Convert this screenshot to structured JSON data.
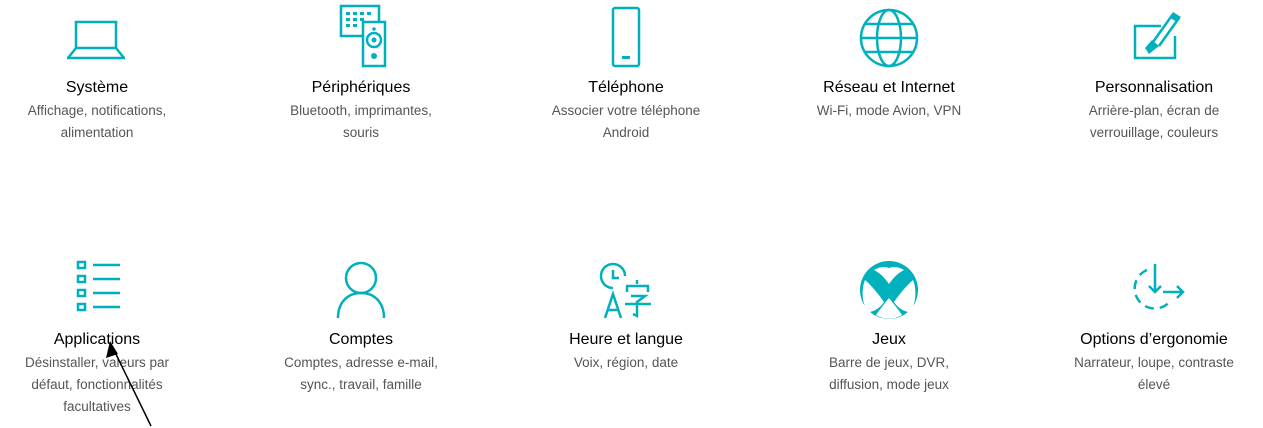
{
  "accent_color": "#00b0bc",
  "tiles": [
    {
      "title": "Système",
      "desc1": "Affichage, notifications,",
      "desc2": "alimentation",
      "desc3": "",
      "icon": "laptop-icon"
    },
    {
      "title": "Périphériques",
      "desc1": "Bluetooth, imprimantes,",
      "desc2": "souris",
      "desc3": "",
      "icon": "devices-icon"
    },
    {
      "title": "Téléphone",
      "desc1": "Associer votre téléphone",
      "desc2": "Android",
      "desc3": "",
      "icon": "phone-icon"
    },
    {
      "title": "Réseau et Internet",
      "desc1": "Wi-Fi, mode Avion, VPN",
      "desc2": "",
      "desc3": "",
      "icon": "globe-icon"
    },
    {
      "title": "Personnalisation",
      "desc1": "Arrière-plan, écran de",
      "desc2": "verrouillage, couleurs",
      "desc3": "",
      "icon": "paintbrush-icon"
    },
    {
      "title": "Applications",
      "desc1": "Désinstaller, valeurs par",
      "desc2": "défaut, fonctionnalités",
      "desc3": "facultatives",
      "icon": "apps-list-icon"
    },
    {
      "title": "Comptes",
      "desc1": "Comptes, adresse e-mail,",
      "desc2": "sync., travail, famille",
      "desc3": "",
      "icon": "person-icon"
    },
    {
      "title": "Heure et langue",
      "desc1": "Voix, région, date",
      "desc2": "",
      "desc3": "",
      "icon": "time-language-icon"
    },
    {
      "title": "Jeux",
      "desc1": "Barre de jeux, DVR,",
      "desc2": "diffusion, mode jeux",
      "desc3": "",
      "icon": "xbox-icon"
    },
    {
      "title": "Options d’ergonomie",
      "desc1": "Narrateur, loupe, contraste",
      "desc2": "élevé",
      "desc3": "",
      "icon": "ease-of-access-icon"
    }
  ]
}
